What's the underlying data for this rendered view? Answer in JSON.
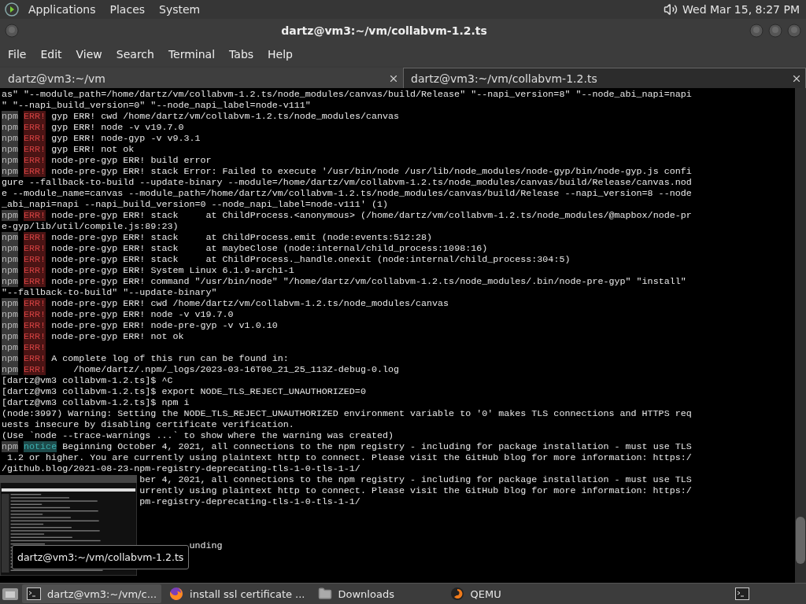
{
  "top_panel": {
    "menus": [
      "Applications",
      "Places",
      "System"
    ],
    "clock": "Wed Mar 15, 8:27 PM"
  },
  "window": {
    "title": "dartz@vm3:~/vm/collabvm-1.2.ts"
  },
  "menubar": [
    "File",
    "Edit",
    "View",
    "Search",
    "Terminal",
    "Tabs",
    "Help"
  ],
  "tabs": [
    {
      "label": "dartz@vm3:~/vm",
      "selected": false
    },
    {
      "label": "dartz@vm3:~/vm/collabvm-1.2.ts",
      "selected": true
    }
  ],
  "terminal": {
    "lines": [
      {
        "kind": "plain",
        "text": "as\" \"--module_path=/home/dartz/vm/collabvm-1.2.ts/node_modules/canvas/build/Release\" \"--napi_version=8\" \"--node_abi_napi=napi"
      },
      {
        "kind": "plain",
        "text": "\" \"--napi_build_version=0\" \"--node_napi_label=node-v111\""
      },
      {
        "kind": "err",
        "tag": "npm",
        "level": "ERR!",
        "text": "gyp ERR! cwd /home/dartz/vm/collabvm-1.2.ts/node_modules/canvas"
      },
      {
        "kind": "err",
        "tag": "npm",
        "level": "ERR!",
        "text": "gyp ERR! node -v v19.7.0"
      },
      {
        "kind": "err",
        "tag": "npm",
        "level": "ERR!",
        "text": "gyp ERR! node-gyp -v v9.3.1"
      },
      {
        "kind": "err",
        "tag": "npm",
        "level": "ERR!",
        "text": "gyp ERR! not ok"
      },
      {
        "kind": "err",
        "tag": "npm",
        "level": "ERR!",
        "text": "node-pre-gyp ERR! build error"
      },
      {
        "kind": "err",
        "tag": "npm",
        "level": "ERR!",
        "text": "node-pre-gyp ERR! stack Error: Failed to execute '/usr/bin/node /usr/lib/node_modules/node-gyp/bin/node-gyp.js confi"
      },
      {
        "kind": "plain",
        "text": "gure --fallback-to-build --update-binary --module=/home/dartz/vm/collabvm-1.2.ts/node_modules/canvas/build/Release/canvas.nod"
      },
      {
        "kind": "plain",
        "text": "e --module_name=canvas --module_path=/home/dartz/vm/collabvm-1.2.ts/node_modules/canvas/build/Release --napi_version=8 --node"
      },
      {
        "kind": "plain",
        "text": "_abi_napi=napi --napi_build_version=0 --node_napi_label=node-v111' (1)"
      },
      {
        "kind": "err",
        "tag": "npm",
        "level": "ERR!",
        "text": "node-pre-gyp ERR! stack     at ChildProcess.<anonymous> (/home/dartz/vm/collabvm-1.2.ts/node_modules/@mapbox/node-pr"
      },
      {
        "kind": "plain",
        "text": "e-gyp/lib/util/compile.js:89:23)"
      },
      {
        "kind": "err",
        "tag": "npm",
        "level": "ERR!",
        "text": "node-pre-gyp ERR! stack     at ChildProcess.emit (node:events:512:28)"
      },
      {
        "kind": "err",
        "tag": "npm",
        "level": "ERR!",
        "text": "node-pre-gyp ERR! stack     at maybeClose (node:internal/child_process:1098:16)"
      },
      {
        "kind": "err",
        "tag": "npm",
        "level": "ERR!",
        "text": "node-pre-gyp ERR! stack     at ChildProcess._handle.onexit (node:internal/child_process:304:5)"
      },
      {
        "kind": "err",
        "tag": "npm",
        "level": "ERR!",
        "text": "node-pre-gyp ERR! System Linux 6.1.9-arch1-1"
      },
      {
        "kind": "err",
        "tag": "npm",
        "level": "ERR!",
        "text": "node-pre-gyp ERR! command \"/usr/bin/node\" \"/home/dartz/vm/collabvm-1.2.ts/node_modules/.bin/node-pre-gyp\" \"install\""
      },
      {
        "kind": "plain",
        "text": "\"--fallback-to-build\" \"--update-binary\""
      },
      {
        "kind": "err",
        "tag": "npm",
        "level": "ERR!",
        "text": "node-pre-gyp ERR! cwd /home/dartz/vm/collabvm-1.2.ts/node_modules/canvas"
      },
      {
        "kind": "err",
        "tag": "npm",
        "level": "ERR!",
        "text": "node-pre-gyp ERR! node -v v19.7.0"
      },
      {
        "kind": "err",
        "tag": "npm",
        "level": "ERR!",
        "text": "node-pre-gyp ERR! node-pre-gyp -v v1.0.10"
      },
      {
        "kind": "err",
        "tag": "npm",
        "level": "ERR!",
        "text": "node-pre-gyp ERR! not ok"
      },
      {
        "kind": "err",
        "tag": "npm",
        "level": "ERR!"
      },
      {
        "kind": "err",
        "tag": "npm",
        "level": "ERR!",
        "text": "A complete log of this run can be found in:"
      },
      {
        "kind": "err",
        "tag": "npm",
        "level": "ERR!",
        "text": "    /home/dartz/.npm/_logs/2023-03-16T00_21_25_113Z-debug-0.log"
      },
      {
        "kind": "plain",
        "text": "[dartz@vm3 collabvm-1.2.ts]$ ^C"
      },
      {
        "kind": "plain",
        "text": "[dartz@vm3 collabvm-1.2.ts]$ export NODE_TLS_REJECT_UNAUTHORIZED=0"
      },
      {
        "kind": "plain",
        "text": "[dartz@vm3 collabvm-1.2.ts]$ npm i"
      },
      {
        "kind": "plain",
        "text": "(node:3997) Warning: Setting the NODE_TLS_REJECT_UNAUTHORIZED environment variable to '0' makes TLS connections and HTTPS req"
      },
      {
        "kind": "plain",
        "text": "uests insecure by disabling certificate verification."
      },
      {
        "kind": "plain",
        "text": "(Use `node --trace-warnings ...` to show where the warning was created)"
      },
      {
        "kind": "notice",
        "tag": "npm",
        "level": "notice",
        "text": "Beginning October 4, 2021, all connections to the npm registry - including for package installation - must use TLS"
      },
      {
        "kind": "plain",
        "text": " 1.2 or higher. You are currently using plaintext http to connect. Please visit the GitHub blog for more information: https:/"
      },
      {
        "kind": "plain",
        "text": "/github.blog/2021-08-23-npm-registry-deprecating-tls-1-0-tls-1-1/"
      },
      {
        "kind": "plain",
        "text": "                         ber 4, 2021, all connections to the npm registry - including for package installation - must use TLS"
      },
      {
        "kind": "plain",
        "text": "                         urrently using plaintext http to connect. Please visit the GitHub blog for more information: https:/"
      },
      {
        "kind": "plain",
        "text": "                         pm-registry-deprecating-tls-1-0-tls-1-1/"
      },
      {
        "kind": "blank"
      },
      {
        "kind": "blank"
      },
      {
        "kind": "blank"
      },
      {
        "kind": "plain",
        "text": "                                  unding"
      }
    ]
  },
  "tooltip": "dartz@vm3:~/vm/collabvm-1.2.ts",
  "taskbar": {
    "items": [
      {
        "kind": "terminal",
        "label": "dartz@vm3:~/vm/c...",
        "selected": true
      },
      {
        "kind": "browser",
        "label": "install ssl certificate ...",
        "selected": false
      },
      {
        "kind": "folder",
        "label": "Downloads",
        "selected": false
      },
      {
        "kind": "emulator",
        "label": "QEMU",
        "selected": false
      }
    ]
  }
}
